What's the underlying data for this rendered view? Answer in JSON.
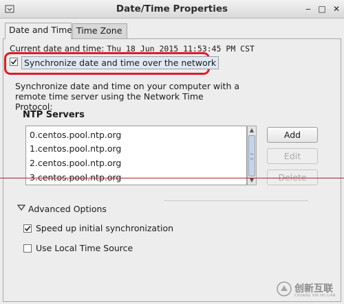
{
  "window": {
    "title": "Date/Time Properties",
    "controls": {
      "minimize": "‒",
      "maximize": "□",
      "close": "✕"
    }
  },
  "tabs": [
    {
      "label": "Date and Time",
      "active": true
    },
    {
      "label": "Time Zone",
      "active": false
    }
  ],
  "current_time": {
    "label": "Current date and time:",
    "value": "Thu 18 Jun 2015 11:53:45 PM CST"
  },
  "sync": {
    "label": "Synchronize date and time over the network",
    "checked": true
  },
  "description": "Synchronize date and time on your computer with a remote time server using the Network Time Protocol:",
  "ntp": {
    "heading": "NTP Servers",
    "servers": [
      "0.centos.pool.ntp.org",
      "1.centos.pool.ntp.org",
      "2.centos.pool.ntp.org",
      "3.centos.pool.ntp.org"
    ],
    "buttons": {
      "add": "Add",
      "edit": "Edit",
      "delete": "Delete"
    }
  },
  "advanced": {
    "label": "Advanced Options",
    "options": [
      {
        "label": "Speed up initial synchronization",
        "checked": true
      },
      {
        "label": "Use Local Time Source",
        "checked": false
      }
    ]
  },
  "watermark": {
    "brand": "创新互联",
    "sub": "CHUANG XIN HU LIAN"
  },
  "colors": {
    "highlight_ring": "#e01b24",
    "selection_bg": "#dfe8f3"
  }
}
